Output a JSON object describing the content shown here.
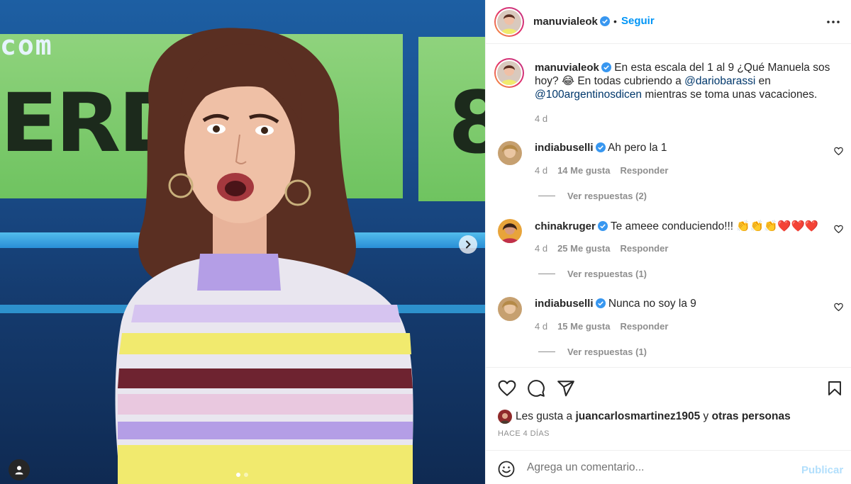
{
  "media": {
    "screen_text": "ERD.",
    "screen_text_2": "8",
    "corner_text": "com",
    "carousel_next_icon": "chevron-right-icon",
    "tag_icon": "user-tag-icon",
    "carousel": {
      "total": 2,
      "current": 1
    }
  },
  "header": {
    "username": "manuvialeok",
    "separator": "•",
    "follow_label": "Seguir",
    "more_icon": "more-horizontal-icon"
  },
  "caption": {
    "username": "manuvialeok",
    "text_1": "En esta escala del 1 al 9 ¿Qué Manuela sos hoy? 😂 En todas cubriendo a ",
    "mention_1": "@dariobarassi",
    "text_2": " en ",
    "mention_2": "@100argentinosdicen",
    "text_3": " mientras se toma unas vacaciones.",
    "time": "4 d"
  },
  "comments": [
    {
      "username": "indiabuselli",
      "text": "Ah pero la 1",
      "time": "4 d",
      "likes": "14 Me gusta",
      "reply": "Responder",
      "view_replies": "Ver respuestas (2)"
    },
    {
      "username": "chinakruger",
      "text": "Te ameee conduciendo!!! 👏👏👏❤️❤️❤️",
      "time": "4 d",
      "likes": "25 Me gusta",
      "reply": "Responder",
      "view_replies": "Ver respuestas (1)"
    },
    {
      "username": "indiabuselli",
      "text": "Nunca no soy la 9",
      "time": "4 d",
      "likes": "15 Me gusta",
      "reply": "Responder",
      "view_replies": "Ver respuestas (1)"
    }
  ],
  "actions": {
    "icons": [
      "heart-icon",
      "comment-icon",
      "share-icon",
      "bookmark-icon"
    ],
    "likes_prefix": "Les gusta a",
    "liker": "juancarlosmartinez1905",
    "likes_mid": "y",
    "likes_others": "otras personas",
    "posted": "HACE 4 DÍAS"
  },
  "add_comment": {
    "emoji_icon": "emoji-icon",
    "placeholder": "Agrega un comentario...",
    "post_label": "Publicar"
  },
  "colors": {
    "link": "#0095f6",
    "mention": "#00376b",
    "verified": "#3897f0",
    "muted": "#8e8e8e"
  }
}
